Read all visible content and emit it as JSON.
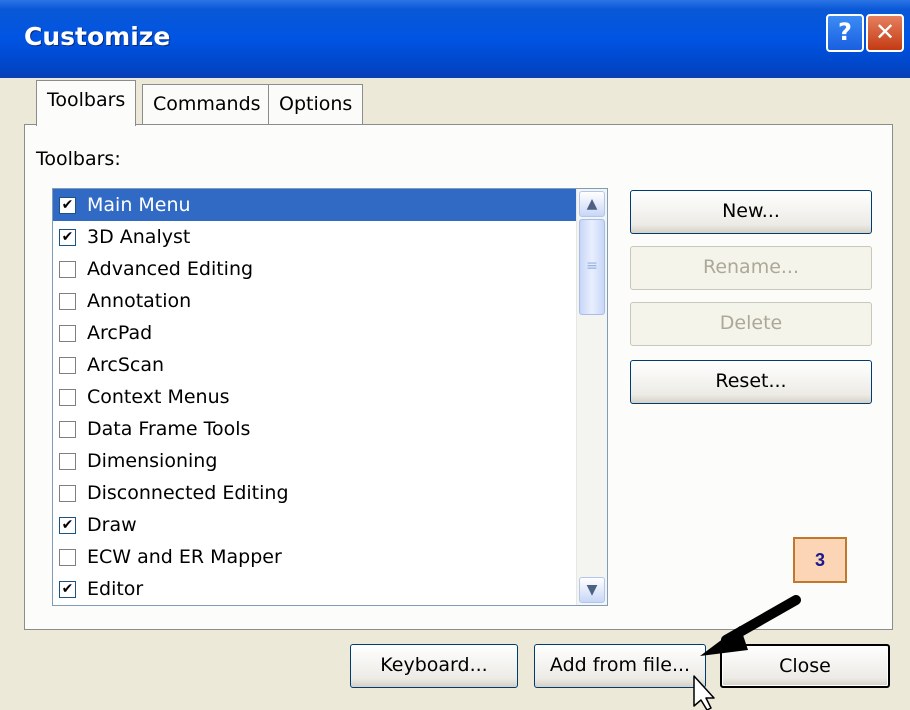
{
  "window": {
    "title": "Customize"
  },
  "titlebar_buttons": {
    "help": "?",
    "close": "✕"
  },
  "tabs": [
    {
      "label": "Toolbars",
      "active": true
    },
    {
      "label": "Commands",
      "active": false
    },
    {
      "label": "Options",
      "active": false
    }
  ],
  "toolbars_label": "Toolbars:",
  "toolbar_list": [
    {
      "label": "Main Menu",
      "checked": true,
      "selected": true
    },
    {
      "label": "3D Analyst",
      "checked": true,
      "selected": false
    },
    {
      "label": "Advanced Editing",
      "checked": false,
      "selected": false
    },
    {
      "label": "Annotation",
      "checked": false,
      "selected": false
    },
    {
      "label": "ArcPad",
      "checked": false,
      "selected": false
    },
    {
      "label": "ArcScan",
      "checked": false,
      "selected": false
    },
    {
      "label": "Context Menus",
      "checked": false,
      "selected": false
    },
    {
      "label": "Data Frame Tools",
      "checked": false,
      "selected": false
    },
    {
      "label": "Dimensioning",
      "checked": false,
      "selected": false
    },
    {
      "label": "Disconnected Editing",
      "checked": false,
      "selected": false
    },
    {
      "label": "Draw",
      "checked": true,
      "selected": false
    },
    {
      "label": "ECW and ER Mapper",
      "checked": false,
      "selected": false
    },
    {
      "label": "Editor",
      "checked": true,
      "selected": false
    }
  ],
  "side_buttons": {
    "new": "New...",
    "rename": "Rename...",
    "delete": "Delete",
    "reset": "Reset..."
  },
  "bottom_buttons": {
    "keyboard": "Keyboard...",
    "add_from_file": "Add from file...",
    "close": "Close"
  },
  "annotation": {
    "step": "3"
  },
  "colors": {
    "title_blue": "#0054e3",
    "selection_blue": "#316ac5",
    "callout_fill": "#fbd5b5"
  }
}
